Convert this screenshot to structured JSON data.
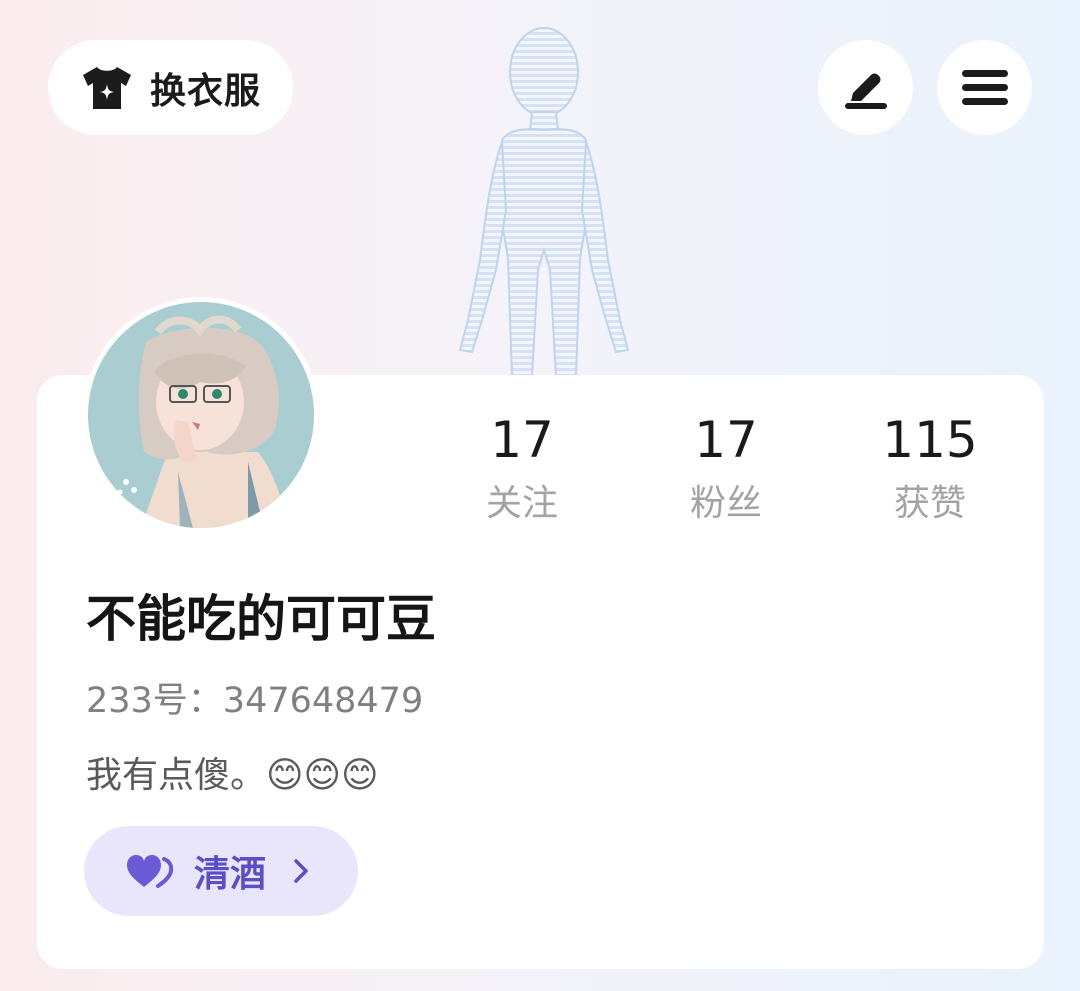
{
  "header": {
    "dress_label": "换衣服",
    "dress_icon": "tshirt-sparkle-icon",
    "edit_icon": "pen-icon",
    "menu_icon": "hamburger-menu-icon"
  },
  "profile": {
    "avatar": "anime-girl-avatar",
    "name": "不能吃的可可豆",
    "id_line": "233号：347648479",
    "bio": "我有点傻。😊😊😊"
  },
  "stats": [
    {
      "value": "17",
      "label": "关注"
    },
    {
      "value": "17",
      "label": "粉丝"
    },
    {
      "value": "115",
      "label": "获赞"
    }
  ],
  "tag": {
    "icon": "double-heart-icon",
    "label": "清酒",
    "chevron": "chevron-right-icon",
    "accent": "#5b4fc6",
    "background": "#e9e6fb"
  }
}
